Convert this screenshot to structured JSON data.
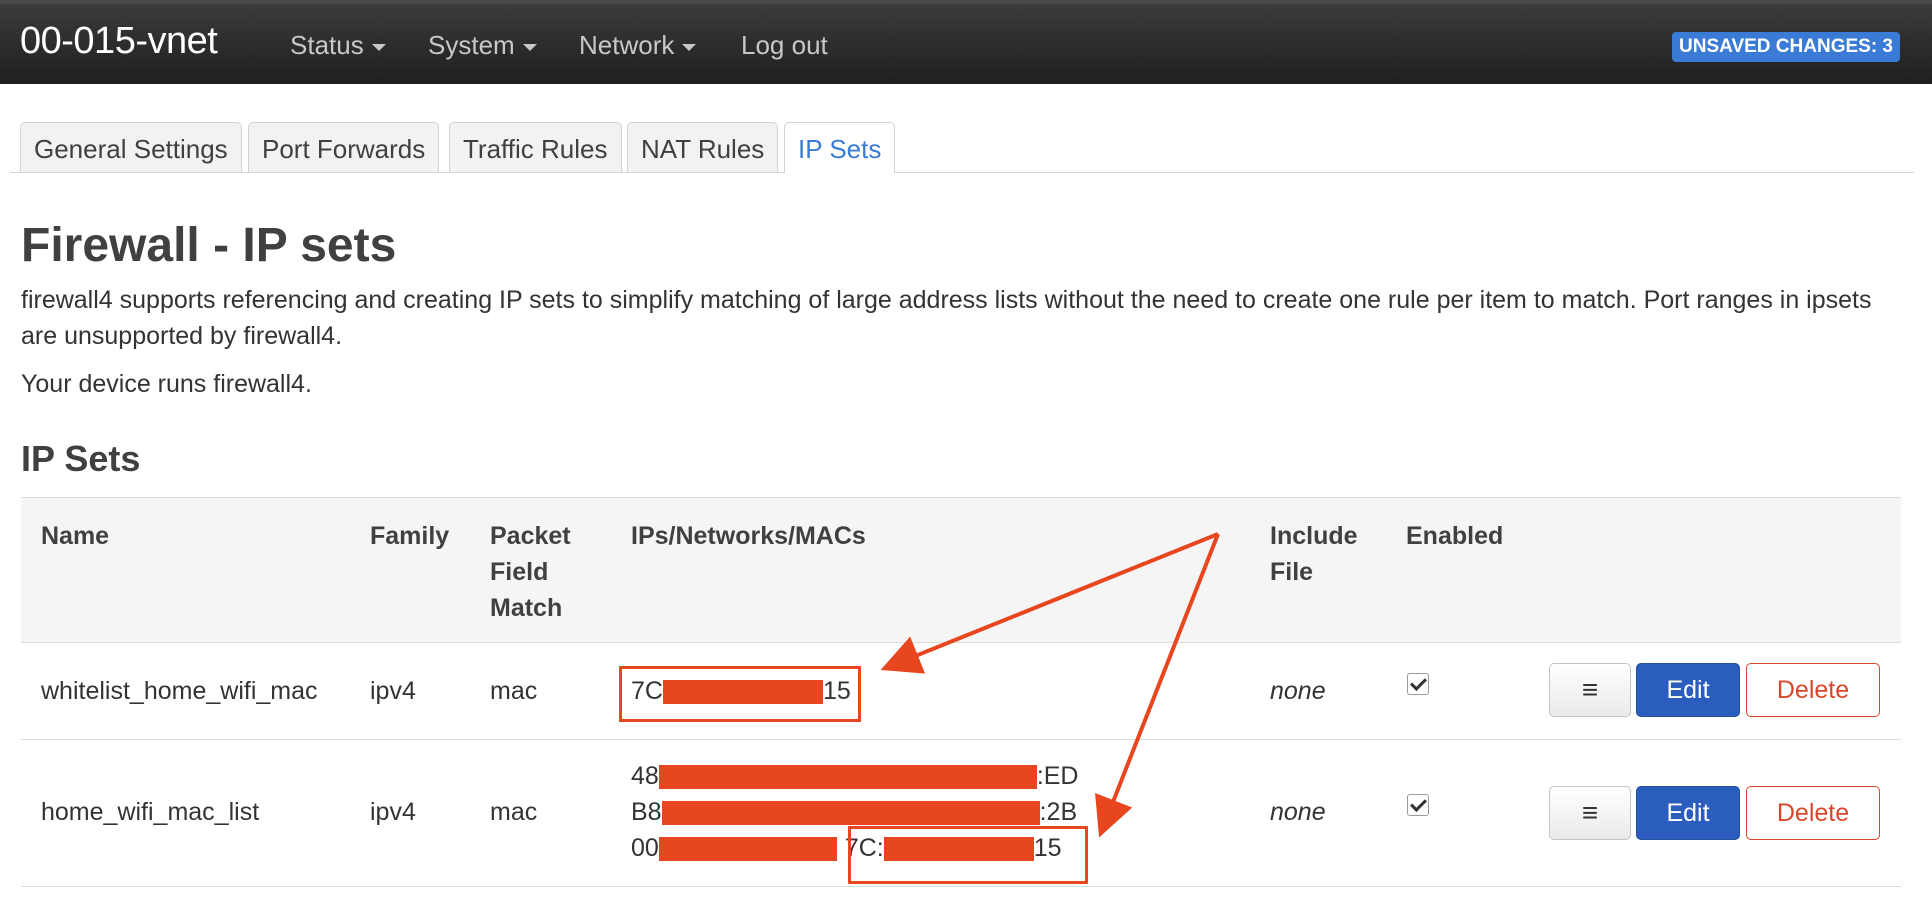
{
  "header": {
    "brand": "00-015-vnet",
    "nav": [
      {
        "label": "Status"
      },
      {
        "label": "System"
      },
      {
        "label": "Network"
      },
      {
        "label": "Log out"
      }
    ],
    "badge": "UNSAVED CHANGES: 3"
  },
  "tabs": [
    {
      "label": "General Settings",
      "active": false
    },
    {
      "label": "Port Forwards",
      "active": false
    },
    {
      "label": "Traffic Rules",
      "active": false
    },
    {
      "label": "NAT Rules",
      "active": false
    },
    {
      "label": "IP Sets",
      "active": true
    }
  ],
  "page": {
    "title": "Firewall - IP sets",
    "description": "firewall4 supports referencing and creating IP sets to simplify matching of large address lists without the need to create one rule per item to match. Port ranges in ipsets are unsupported by firewall4.",
    "runs": "Your device runs firewall4.",
    "section": "IP Sets"
  },
  "table": {
    "headers": {
      "name": "Name",
      "family": "Family",
      "packet_line1": "Packet",
      "packet_line2": "Field",
      "packet_line3": "Match",
      "ips": "IPs/Networks/MACs",
      "include_line1": "Include",
      "include_line2": "File",
      "enabled": "Enabled"
    },
    "rows": [
      {
        "name": "whitelist_home_wifi_mac",
        "family": "ipv4",
        "match": "mac",
        "ips": [
          {
            "start": "7C",
            "end": "15"
          }
        ],
        "include": "none",
        "enabled": true
      },
      {
        "name": "home_wifi_mac_list",
        "family": "ipv4",
        "match": "mac",
        "ips": [
          {
            "start": "48",
            "end": ":ED"
          },
          {
            "start": "B8",
            "end": ":2B"
          },
          {
            "start": "00",
            "end": "",
            "second_start": "7C:",
            "second_end": "15"
          }
        ],
        "include": "none",
        "enabled": true
      }
    ],
    "actions": {
      "more": "≡",
      "edit": "Edit",
      "delete": "Delete"
    }
  },
  "colors": {
    "annotation": "#e8461e",
    "accent": "#3a7bd5",
    "edit_button": "#2a5dbd"
  }
}
